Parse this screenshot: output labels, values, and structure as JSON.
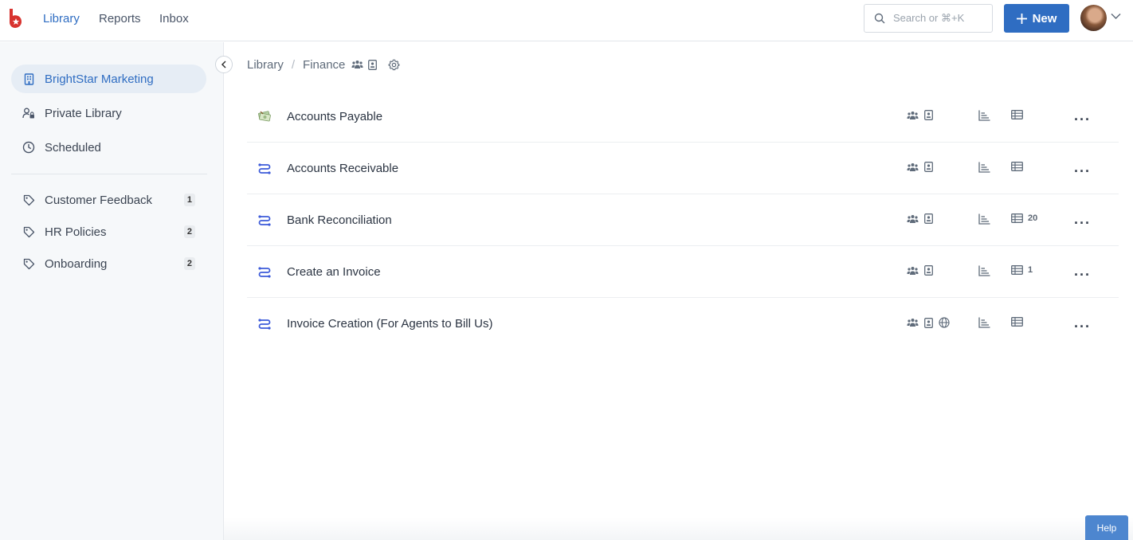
{
  "topnav": {
    "logo_icon": "bird-logo-icon",
    "items": [
      {
        "label": "Library",
        "active": true
      },
      {
        "label": "Reports",
        "active": false
      },
      {
        "label": "Inbox",
        "active": false
      }
    ],
    "search_placeholder": "Search or ⌘+K",
    "new_label": "New",
    "accent": "#2f6dc2"
  },
  "sidebar": {
    "workspaces": [
      {
        "label": "BrightStar Marketing",
        "icon": "building-icon",
        "active": true
      },
      {
        "label": "Private Library",
        "icon": "user-lock-icon",
        "active": false
      },
      {
        "label": "Scheduled",
        "icon": "clock-icon",
        "active": false
      }
    ],
    "tags": [
      {
        "label": "Customer Feedback",
        "count": "1",
        "icon": "tag-icon"
      },
      {
        "label": "HR Policies",
        "count": "2",
        "icon": "tag-icon"
      },
      {
        "label": "Onboarding",
        "count": "2",
        "icon": "tag-icon"
      }
    ]
  },
  "breadcrumb": {
    "root": "Library",
    "separator": "/",
    "current": "Finance"
  },
  "rows": [
    {
      "title": "Accounts Payable",
      "icon": "money-icon",
      "public": false,
      "table_count": ""
    },
    {
      "title": "Accounts Receivable",
      "icon": "workflow-icon",
      "public": false,
      "table_count": ""
    },
    {
      "title": "Bank Reconciliation",
      "icon": "workflow-icon",
      "public": false,
      "table_count": "20"
    },
    {
      "title": "Create an Invoice",
      "icon": "workflow-icon",
      "public": false,
      "table_count": "1"
    },
    {
      "title": "Invoice Creation (For Agents to Bill Us)",
      "icon": "workflow-icon",
      "public": true,
      "table_count": ""
    }
  ],
  "more_glyph": "···",
  "help_label": "Help"
}
